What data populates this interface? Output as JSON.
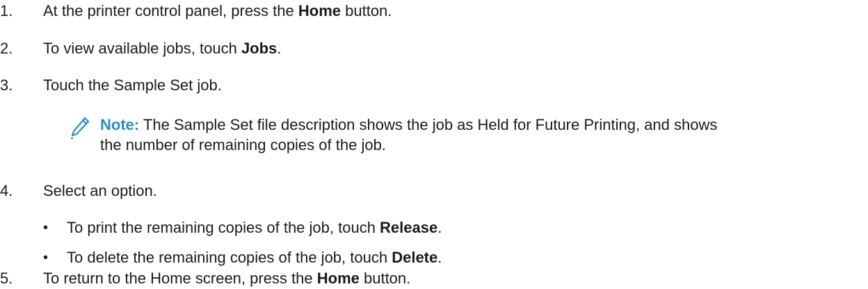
{
  "steps": [
    {
      "num": "1.",
      "pre": "At the printer control panel, press the ",
      "bold": "Home",
      "post": " button."
    },
    {
      "num": "2.",
      "pre": "To view available jobs, touch ",
      "bold": "Jobs",
      "post": "."
    },
    {
      "num": "3.",
      "pre": "Touch the Sample Set job.",
      "bold": "",
      "post": ""
    },
    {
      "num": "4.",
      "pre": "Select an option.",
      "bold": "",
      "post": ""
    },
    {
      "num": "5.",
      "pre": "To return to the Home screen, press the ",
      "bold": "Home",
      "post": " button."
    }
  ],
  "note": {
    "label": "Note:",
    "line1": " The Sample Set file description shows the job as Held for Future Printing, and shows",
    "line2": "the number of remaining copies of the job.",
    "icon": "pencil-icon",
    "color": "#2b8cc4"
  },
  "bullets": [
    {
      "pre": "To print the remaining copies of the job, touch ",
      "bold": "Release",
      "post": "."
    },
    {
      "pre": "To delete the remaining copies of the job, touch ",
      "bold": "Delete",
      "post": "."
    }
  ]
}
